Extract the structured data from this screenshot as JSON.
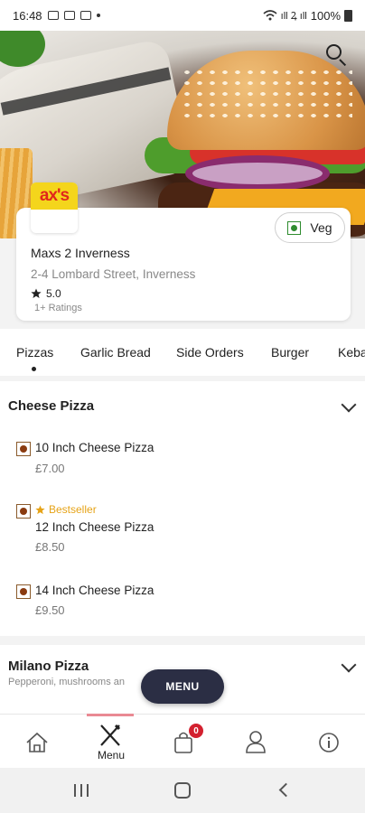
{
  "status_bar": {
    "time": "16:48",
    "battery": "100%",
    "signal_text": "ıll Ꝝ ıll"
  },
  "restaurant": {
    "logo_text": "ax's",
    "name": "Maxs 2 Inverness",
    "address": "2-4 Lombard Street, Inverness",
    "rating": "5.0",
    "ratings_count": "1+ Ratings",
    "veg_label": "Veg"
  },
  "categories": [
    "Pizzas",
    "Garlic Bread",
    "Side Orders",
    "Burger",
    "Keba"
  ],
  "sections": [
    {
      "title": "Cheese Pizza",
      "items": [
        {
          "name": "10 Inch Cheese Pizza",
          "price": "£7.00",
          "tag": ""
        },
        {
          "name": "12 Inch Cheese Pizza",
          "price": "£8.50",
          "tag": "Bestseller"
        },
        {
          "name": "14 Inch Cheese Pizza",
          "price": "£9.50",
          "tag": ""
        }
      ]
    },
    {
      "title": "Milano Pizza",
      "description": "Pepperoni, mushrooms an"
    }
  ],
  "menu_button": "MENU",
  "bottom_nav": {
    "menu_label": "Menu",
    "cart_count": "0"
  },
  "colors": {
    "accent": "#2b2e44",
    "bestseller": "#e6a317",
    "veg": "#2e8b2e",
    "badge": "#d3202f"
  },
  "icons": [
    "search-icon",
    "veg-icon",
    "star-icon",
    "chevron-down-icon",
    "home-icon",
    "fork-knife-icon",
    "cart-icon",
    "user-icon",
    "info-icon"
  ]
}
